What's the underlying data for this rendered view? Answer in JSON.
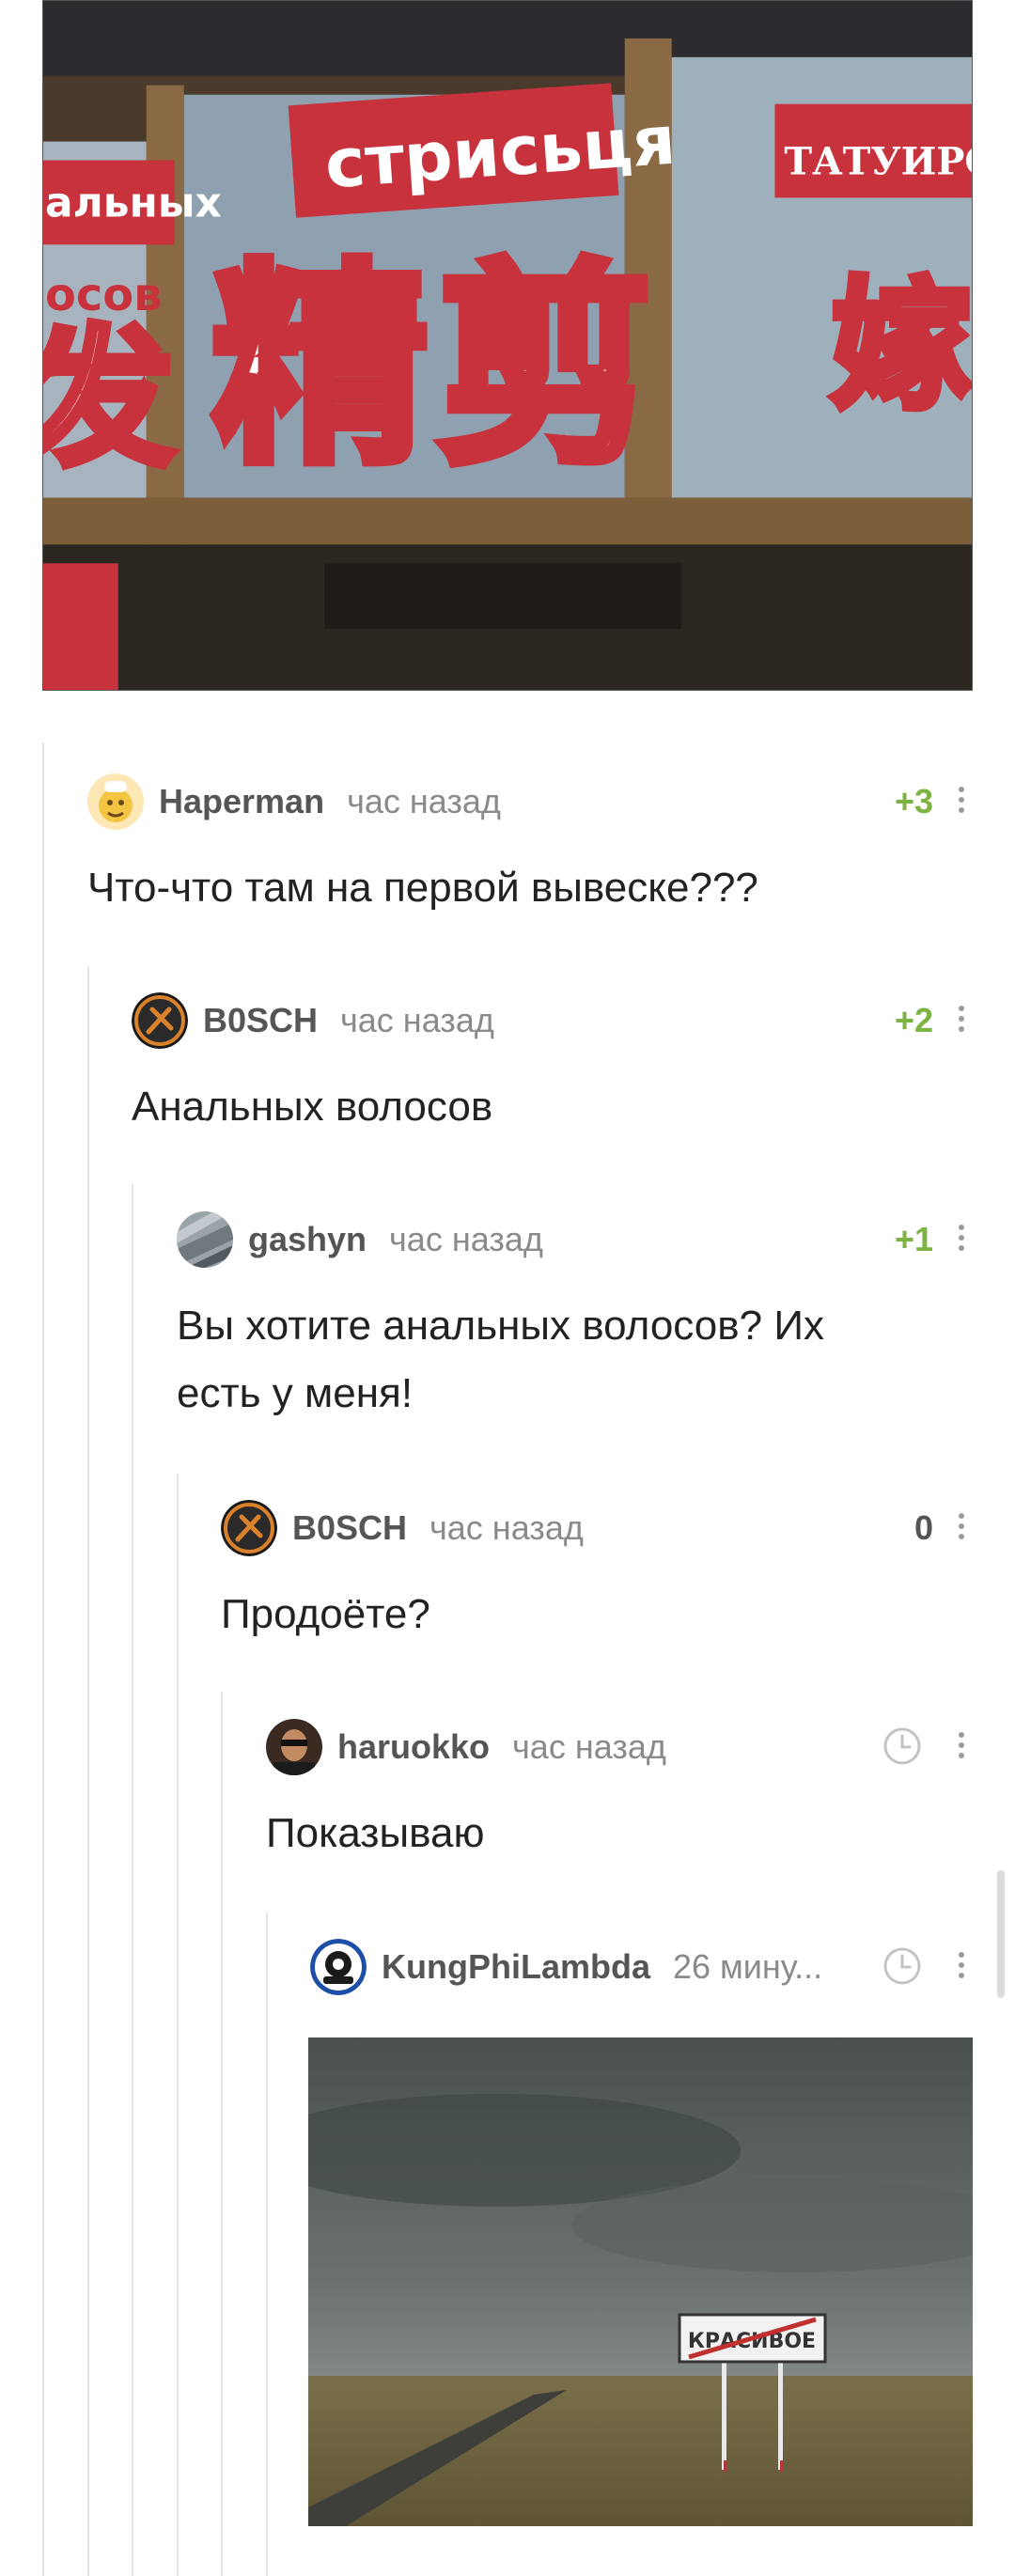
{
  "top_photo": {
    "sign_top": "стрисьця",
    "sign_left_1": "альных",
    "sign_left_2": "осов",
    "sign_right": "ТАТУИРОВКА",
    "hanzi_1": "精",
    "hanzi_2": "剪",
    "hanzi_left": "发",
    "hanzi_right": "嫁"
  },
  "comments": [
    {
      "user": "Haperman",
      "time": "час назад",
      "score": "+3",
      "text": "Что-что там на первой вывеске???"
    },
    {
      "user": "B0SCH",
      "time": "час назад",
      "score": "+2",
      "text": "Анальных волосов"
    },
    {
      "user": "gashyn",
      "time": "час назад",
      "score": "+1",
      "text_line1": "Вы хотите анальных волосов? Их",
      "text_line2": "есть у меня!"
    },
    {
      "user": "B0SCH",
      "time": "час назад",
      "score": "0",
      "text": "Продоёте?"
    },
    {
      "user": "haruokko",
      "time": "час назад",
      "text": "Показываю"
    },
    {
      "user": "KungPhiLambda",
      "time": "26 мину..."
    }
  ],
  "bottom_photo": {
    "sign_text": "КРАСИВОЕ"
  },
  "colors": {
    "positive_score": "#7cb342",
    "thread_line": "#e6e6e6",
    "meta_gray": "#8a8a8a"
  },
  "icons": [
    "dots-vertical-icon",
    "clock-icon"
  ]
}
